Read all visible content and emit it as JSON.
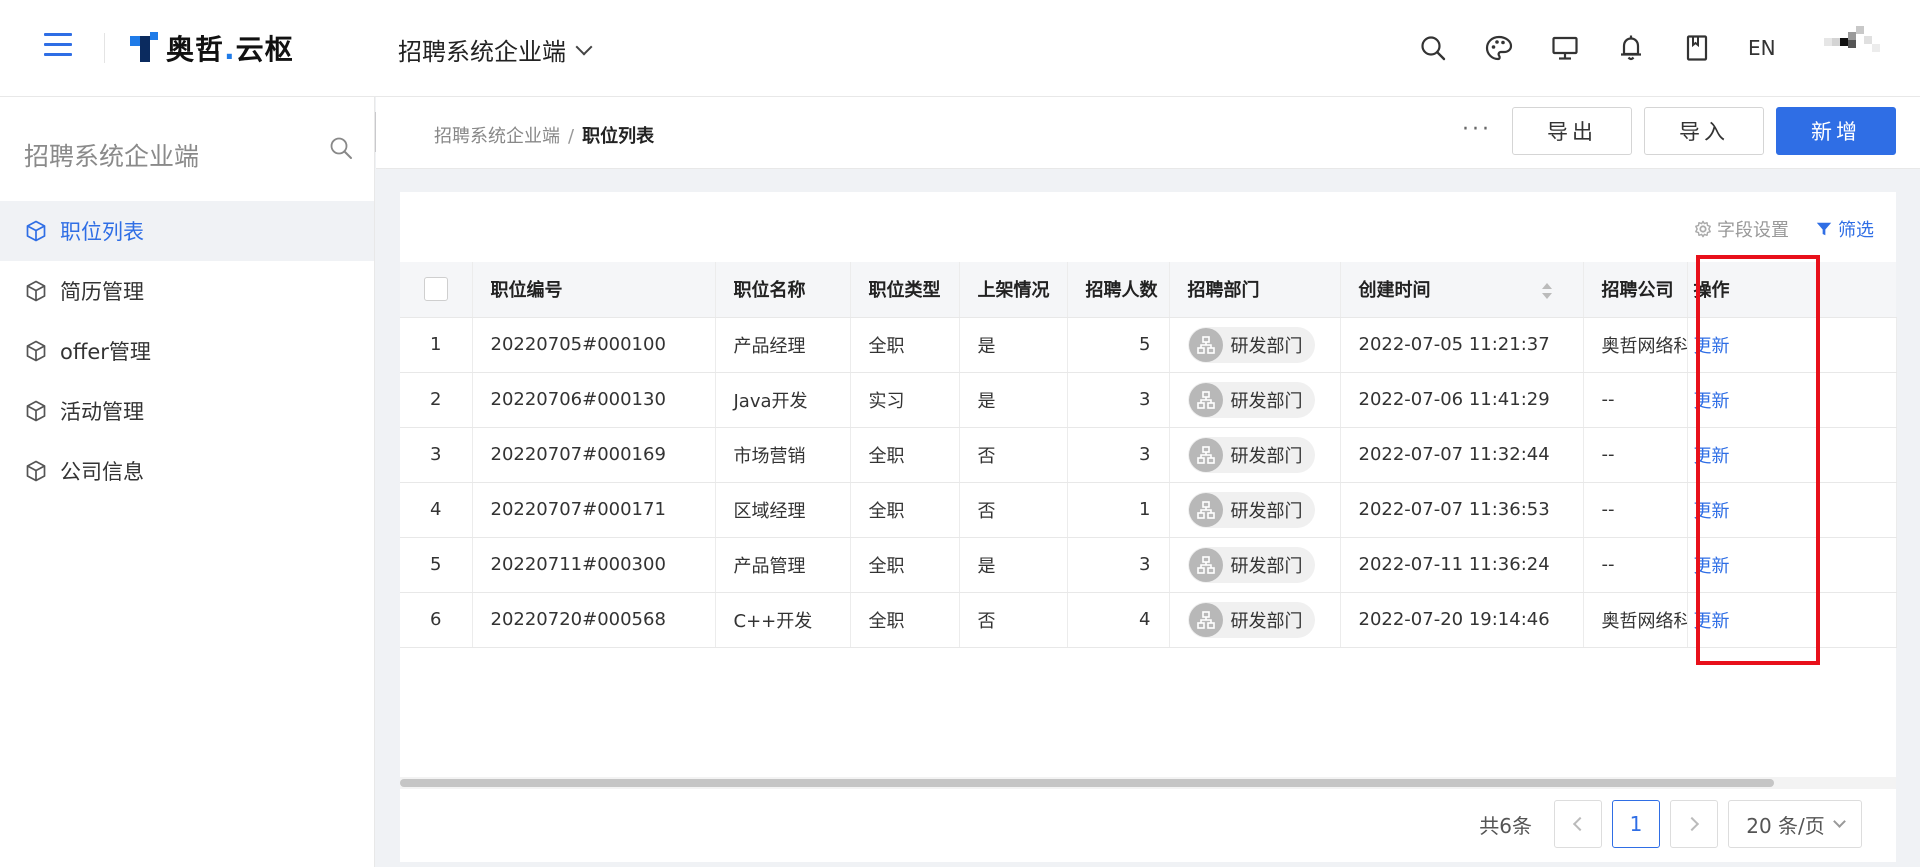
{
  "header": {
    "logo_text_a": "奥哲",
    "logo_dot": ".",
    "logo_text_b": "云枢",
    "system_name": "招聘系统企业端",
    "lang": "EN",
    "icons": [
      "menu-icon",
      "search-icon",
      "palette-icon",
      "monitor-icon",
      "bell-icon",
      "book-icon",
      "avatar"
    ]
  },
  "sidebar": {
    "title": "招聘系统企业端",
    "items": [
      {
        "label": "职位列表",
        "active": true
      },
      {
        "label": "简历管理",
        "active": false
      },
      {
        "label": "offer管理",
        "active": false
      },
      {
        "label": "活动管理",
        "active": false
      },
      {
        "label": "公司信息",
        "active": false
      }
    ]
  },
  "breadcrumb": {
    "parent": "招聘系统企业端",
    "separator": "/",
    "current": "职位列表"
  },
  "actions": {
    "more": "···",
    "export": "导出",
    "import": "导入",
    "add": "新增"
  },
  "table_tools": {
    "field_settings": "字段设置",
    "filter": "筛选"
  },
  "table": {
    "columns": [
      "职位编号",
      "职位名称",
      "职位类型",
      "上架情况",
      "招聘人数",
      "招聘部门",
      "创建时间",
      "招聘公司",
      "操作"
    ],
    "rows": [
      {
        "idx": "1",
        "code": "20220705#000100",
        "name": "产品经理",
        "type": "全职",
        "listed": "是",
        "count": "5",
        "dept": "研发部门",
        "created": "2022-07-05 11:21:37",
        "company": "奥哲网络科技",
        "op": "更新"
      },
      {
        "idx": "2",
        "code": "20220706#000130",
        "name": "Java开发",
        "type": "实习",
        "listed": "是",
        "count": "3",
        "dept": "研发部门",
        "created": "2022-07-06 11:41:29",
        "company": "--",
        "op": "更新"
      },
      {
        "idx": "3",
        "code": "20220707#000169",
        "name": "市场营销",
        "type": "全职",
        "listed": "否",
        "count": "3",
        "dept": "研发部门",
        "created": "2022-07-07 11:32:44",
        "company": "--",
        "op": "更新"
      },
      {
        "idx": "4",
        "code": "20220707#000171",
        "name": "区域经理",
        "type": "全职",
        "listed": "否",
        "count": "1",
        "dept": "研发部门",
        "created": "2022-07-07 11:36:53",
        "company": "--",
        "op": "更新"
      },
      {
        "idx": "5",
        "code": "20220711#000300",
        "name": "产品管理",
        "type": "全职",
        "listed": "是",
        "count": "3",
        "dept": "研发部门",
        "created": "2022-07-11 11:36:24",
        "company": "--",
        "op": "更新"
      },
      {
        "idx": "6",
        "code": "20220720#000568",
        "name": "C++开发",
        "type": "全职",
        "listed": "否",
        "count": "4",
        "dept": "研发部门",
        "created": "2022-07-20 19:14:46",
        "company": "奥哲网络科技",
        "op": "更新"
      }
    ]
  },
  "pagination": {
    "total": "共6条",
    "current_page": "1",
    "page_size": "20 条/页"
  },
  "colors": {
    "primary": "#2f6ee5",
    "highlight": "#e8101a"
  }
}
